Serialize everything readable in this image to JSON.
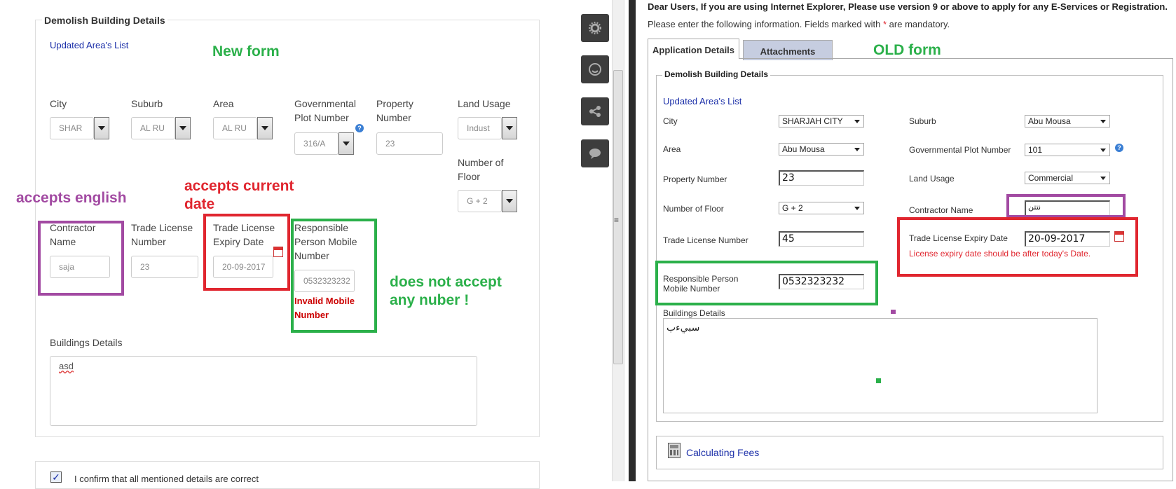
{
  "new_form": {
    "legend": "Demolish Building Details",
    "updated_areas_link": "Updated Area's List",
    "annotation_title": "New form",
    "fields": {
      "city": {
        "label": "City",
        "value": "SHAR"
      },
      "suburb": {
        "label": "Suburb",
        "value": "AL RU"
      },
      "area": {
        "label": "Area",
        "value": "AL RU"
      },
      "gov_plot": {
        "label": "Governmental Plot Number",
        "value": "316/A"
      },
      "property_number": {
        "label": "Property Number",
        "value": "23"
      },
      "land_usage": {
        "label": "Land Usage",
        "value": "Indust"
      },
      "number_of_floor": {
        "label": "Number of Floor",
        "value": "G + 2"
      },
      "contractor_name": {
        "label": "Contractor Name",
        "value": "saja"
      },
      "trade_license_number": {
        "label": "Trade License Number",
        "value": "23"
      },
      "trade_license_expiry": {
        "label": "Trade License Expiry Date",
        "value": "20-09-2017"
      },
      "responsible_mobile": {
        "label": "Responsible Person Mobile Number",
        "value": "0532323232",
        "error": "Invalid Mobile Number"
      },
      "buildings_details": {
        "label": "Buildings Details",
        "value": "asd"
      }
    },
    "confirm_text": "I confirm that all mentioned details are correct"
  },
  "annotations": {
    "accepts_english": "accepts english",
    "accepts_current_date": "accepts current date",
    "does_not_accept": "does not accept any nuber !",
    "old_form": "OLD form"
  },
  "old_form": {
    "notice": "Dear Users, If you are using Internet Explorer, Please use version 9 or above to apply for any E-Services or Registration.",
    "instructions_before": "Please enter the following information. Fields marked with ",
    "required_mark": "*",
    "instructions_after": " are mandatory.",
    "tabs": [
      "Application Details",
      "Attachments"
    ],
    "legend": "Demolish Building Details",
    "updated_areas_link": "Updated Area's List",
    "fields": {
      "city": {
        "label": "City",
        "value": "SHARJAH CITY"
      },
      "suburb": {
        "label": "Suburb",
        "value": "Abu Mousa"
      },
      "area": {
        "label": "Area",
        "value": "Abu Mousa"
      },
      "gov_plot": {
        "label": "Governmental Plot Number",
        "value": "101"
      },
      "property_number": {
        "label": "Property Number",
        "value": "23"
      },
      "land_usage": {
        "label": "Land Usage",
        "value": "Commercial"
      },
      "number_of_floor": {
        "label": "Number of Floor",
        "value": "G + 2"
      },
      "contractor_name": {
        "label": "Contractor Name",
        "value": "نتتن"
      },
      "trade_license_number": {
        "label": "Trade License Number",
        "value": "45"
      },
      "trade_license_expiry": {
        "label": "Trade License Expiry Date",
        "value": "20-09-2017",
        "error": "License expiry date should be after today's Date."
      },
      "responsible_mobile": {
        "label": "Responsible Person Mobile Number",
        "value": "0532323232"
      },
      "buildings_details": {
        "label": "Buildings Details",
        "value": "سبيءب"
      }
    },
    "calculating_fees": "Calculating Fees"
  },
  "icons": [
    "gear-icon",
    "smiley-icon",
    "share-icon",
    "comment-icon",
    "help-icon",
    "calendar-icon",
    "calculator-icon",
    "checkbox-icon"
  ],
  "colors": {
    "annotation_green": "#2bb04a",
    "annotation_red": "#e0262f",
    "annotation_purple": "#a24aa2",
    "link_blue": "#1a2ea8"
  }
}
